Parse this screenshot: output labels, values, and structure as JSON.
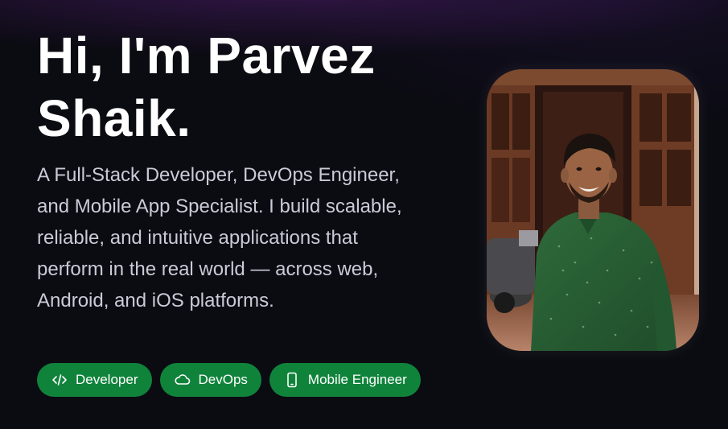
{
  "hero": {
    "title_line1": "Hi, I'm Parvez",
    "title_line2": "Shaik.",
    "description": "A Full-Stack Developer, DevOps Engineer, and Mobile App Specialist. I build scalable, reliable, and intuitive applications that perform in the real world — across web, Android, and iOS platforms."
  },
  "tags": [
    {
      "label": "Developer",
      "icon": "code-icon"
    },
    {
      "label": "DevOps",
      "icon": "cloud-icon"
    },
    {
      "label": "Mobile Engineer",
      "icon": "smartphone-icon"
    }
  ],
  "colors": {
    "background": "#0b0b12",
    "tag_green": "#10833b",
    "text_muted": "#c9cbd6"
  },
  "photo": {
    "subject": "profile-photo"
  }
}
